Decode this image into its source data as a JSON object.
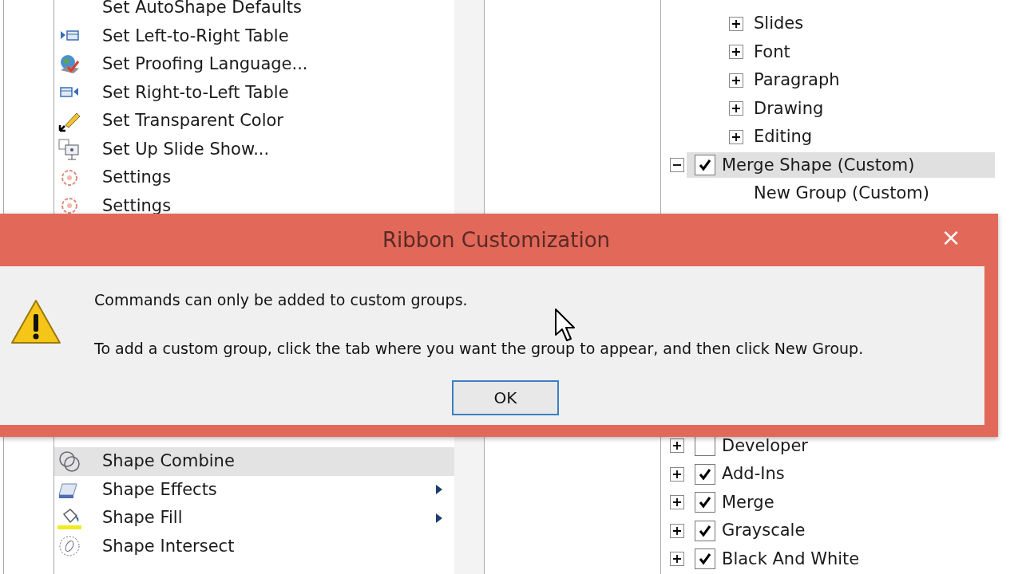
{
  "commands_list": {
    "upper": [
      {
        "label": "Set AutoShape Defaults",
        "selected": false,
        "submenu": false
      },
      {
        "label": "Set Left-to-Right Table",
        "selected": false,
        "submenu": false
      },
      {
        "label": "Set Proofing Language...",
        "selected": false,
        "submenu": false
      },
      {
        "label": "Set Right-to-Left Table",
        "selected": false,
        "submenu": false
      },
      {
        "label": "Set Transparent Color",
        "selected": false,
        "submenu": false
      },
      {
        "label": "Set Up Slide Show...",
        "selected": false,
        "submenu": false
      },
      {
        "label": "Settings",
        "selected": false,
        "submenu": false
      },
      {
        "label": "Settings",
        "selected": false,
        "submenu": false
      }
    ],
    "lower": [
      {
        "label": "Shape Combine",
        "selected": true,
        "submenu": false
      },
      {
        "label": "Shape Effects",
        "selected": false,
        "submenu": true
      },
      {
        "label": "Shape Fill",
        "selected": false,
        "submenu": true
      },
      {
        "label": "Shape Intersect",
        "selected": false,
        "submenu": false
      }
    ]
  },
  "ribbon_tree": {
    "upper": [
      {
        "kind": "group",
        "label": "Slides",
        "expanded": false,
        "selected": false
      },
      {
        "kind": "group",
        "label": "Font",
        "expanded": false,
        "selected": false
      },
      {
        "kind": "group",
        "label": "Paragraph",
        "expanded": false,
        "selected": false
      },
      {
        "kind": "group",
        "label": "Drawing",
        "expanded": false,
        "selected": false
      },
      {
        "kind": "group",
        "label": "Editing",
        "expanded": false,
        "selected": false
      },
      {
        "kind": "tab",
        "label": "Merge Shape (Custom)",
        "checked": true,
        "expanded": true,
        "selected": true,
        "children": [
          {
            "kind": "group",
            "label": "New Group (Custom)",
            "selected": false
          }
        ]
      }
    ],
    "lower": [
      {
        "kind": "tab",
        "label": "Developer",
        "checked": false,
        "expanded": false,
        "selected": false
      },
      {
        "kind": "tab",
        "label": "Add-Ins",
        "checked": true,
        "expanded": false,
        "selected": false
      },
      {
        "kind": "tab",
        "label": "Merge",
        "checked": true,
        "expanded": false,
        "selected": false
      },
      {
        "kind": "tab",
        "label": "Grayscale",
        "checked": true,
        "expanded": false,
        "selected": false
      },
      {
        "kind": "tab",
        "label": "Black And White",
        "checked": true,
        "expanded": false,
        "selected": false
      }
    ]
  },
  "dialog": {
    "title": "Ribbon Customization",
    "close": "×",
    "messages": [
      "Commands can only be added to custom groups.",
      "To add a custom group, click the tab where you want the group to appear, and then click New Group."
    ],
    "buttons": [
      "OK"
    ]
  }
}
